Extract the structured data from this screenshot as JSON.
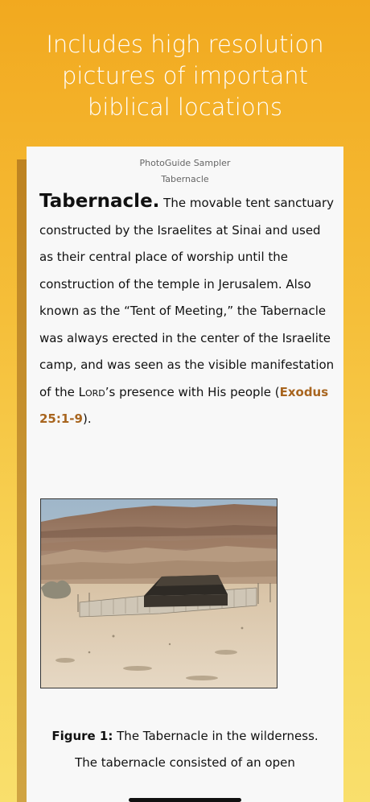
{
  "headline": "Includes high resolution pictures of important biblical locations",
  "card": {
    "app_name": "PhotoGuide Sampler",
    "section": "Tabernacle",
    "term": "Tabernacle.",
    "text_1": " The movable tent sanctuary constructed by the Israelites at Sinai and used as their central place of worship until the construction of the temple in Jerusalem. Also known as the “Tent of Meeting,” the Tabernacle was always erected in the center of the Israelite camp, and was seen as the visible manifestation of the ",
    "lord": "Lord",
    "text_2": "’s presence with His people (",
    "reference": "Exodus 25:1-9",
    "text_3": ").",
    "figure_label": "Figure 1:",
    "figure_caption": " The Tabernacle in the wilderness.",
    "caption_continued": "The tabernacle consisted of an open"
  },
  "colors": {
    "gradient_top": "#f2a91f",
    "gradient_bottom": "#f9df6c",
    "link": "#a8651f"
  },
  "image": {
    "subject": "tabernacle-replica-in-desert-photo"
  }
}
